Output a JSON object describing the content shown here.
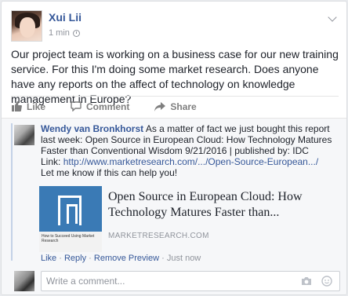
{
  "post": {
    "author": "Xui Lii",
    "time": "1 min",
    "text": "Our project team is working on a business case for our new training service. For this I'm doing some market research. Does anyone have any reports on the affect of technology on knowledge management in Europe?",
    "actions": {
      "like": "Like",
      "comment": "Comment",
      "share": "Share"
    }
  },
  "comment": {
    "author": "Wendy van Bronkhorst",
    "text_1": "As a matter of fact we just bought this report last week: Open Source in European Cloud: How Technology Matures Faster than Conventional Wisdom 9/21/2016 | published by: IDC",
    "link_label": "Link:",
    "link_url": "http://www.marketresearch.com/.../Open-Source-European.../",
    "text_2": "Let me know if this can help you!",
    "preview": {
      "title": "Open Source in European Cloud: How Technology Matures Faster than...",
      "domain": "MARKETRESEARCH.COM",
      "thumb_caption": "How to Succeed Using Market Research"
    },
    "links": {
      "like": "Like",
      "reply": "Reply",
      "remove_preview": "Remove Preview",
      "time": "Just now"
    }
  },
  "composer": {
    "placeholder": "Write a comment..."
  },
  "colors": {
    "link_blue": "#365899",
    "thumb_blue": "#3a7ab5",
    "muted": "#90949c"
  }
}
